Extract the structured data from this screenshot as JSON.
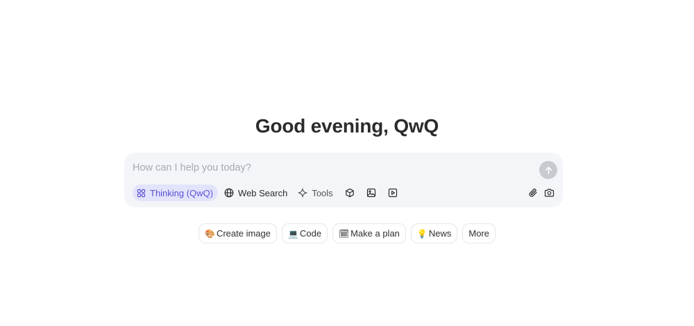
{
  "greeting": "Good evening, QwQ",
  "composer": {
    "placeholder": "How can I help you today?",
    "send_icon": "arrow-up-icon",
    "tools": {
      "thinking": {
        "label": "Thinking (QwQ)",
        "icon": "thinking-icon",
        "active": true,
        "accent": "#5a50d6",
        "bg": "#e3e4fb"
      },
      "web_search": {
        "label": "Web Search",
        "icon": "globe-icon"
      },
      "tools": {
        "label": "Tools",
        "icon": "sparkle-icon"
      },
      "artifacts": {
        "icon": "cube-icon"
      },
      "image": {
        "icon": "image-icon"
      },
      "video": {
        "icon": "video-icon"
      }
    },
    "attach_icon": "paperclip-icon",
    "camera_icon": "camera-icon"
  },
  "suggestions": [
    {
      "emoji": "🎨",
      "label": "Create image"
    },
    {
      "emoji": "💻",
      "label": "Code"
    },
    {
      "emoji": "🗓",
      "label": "Make a plan"
    },
    {
      "emoji": "💡",
      "label": "News"
    },
    {
      "emoji": "",
      "label": "More"
    }
  ]
}
